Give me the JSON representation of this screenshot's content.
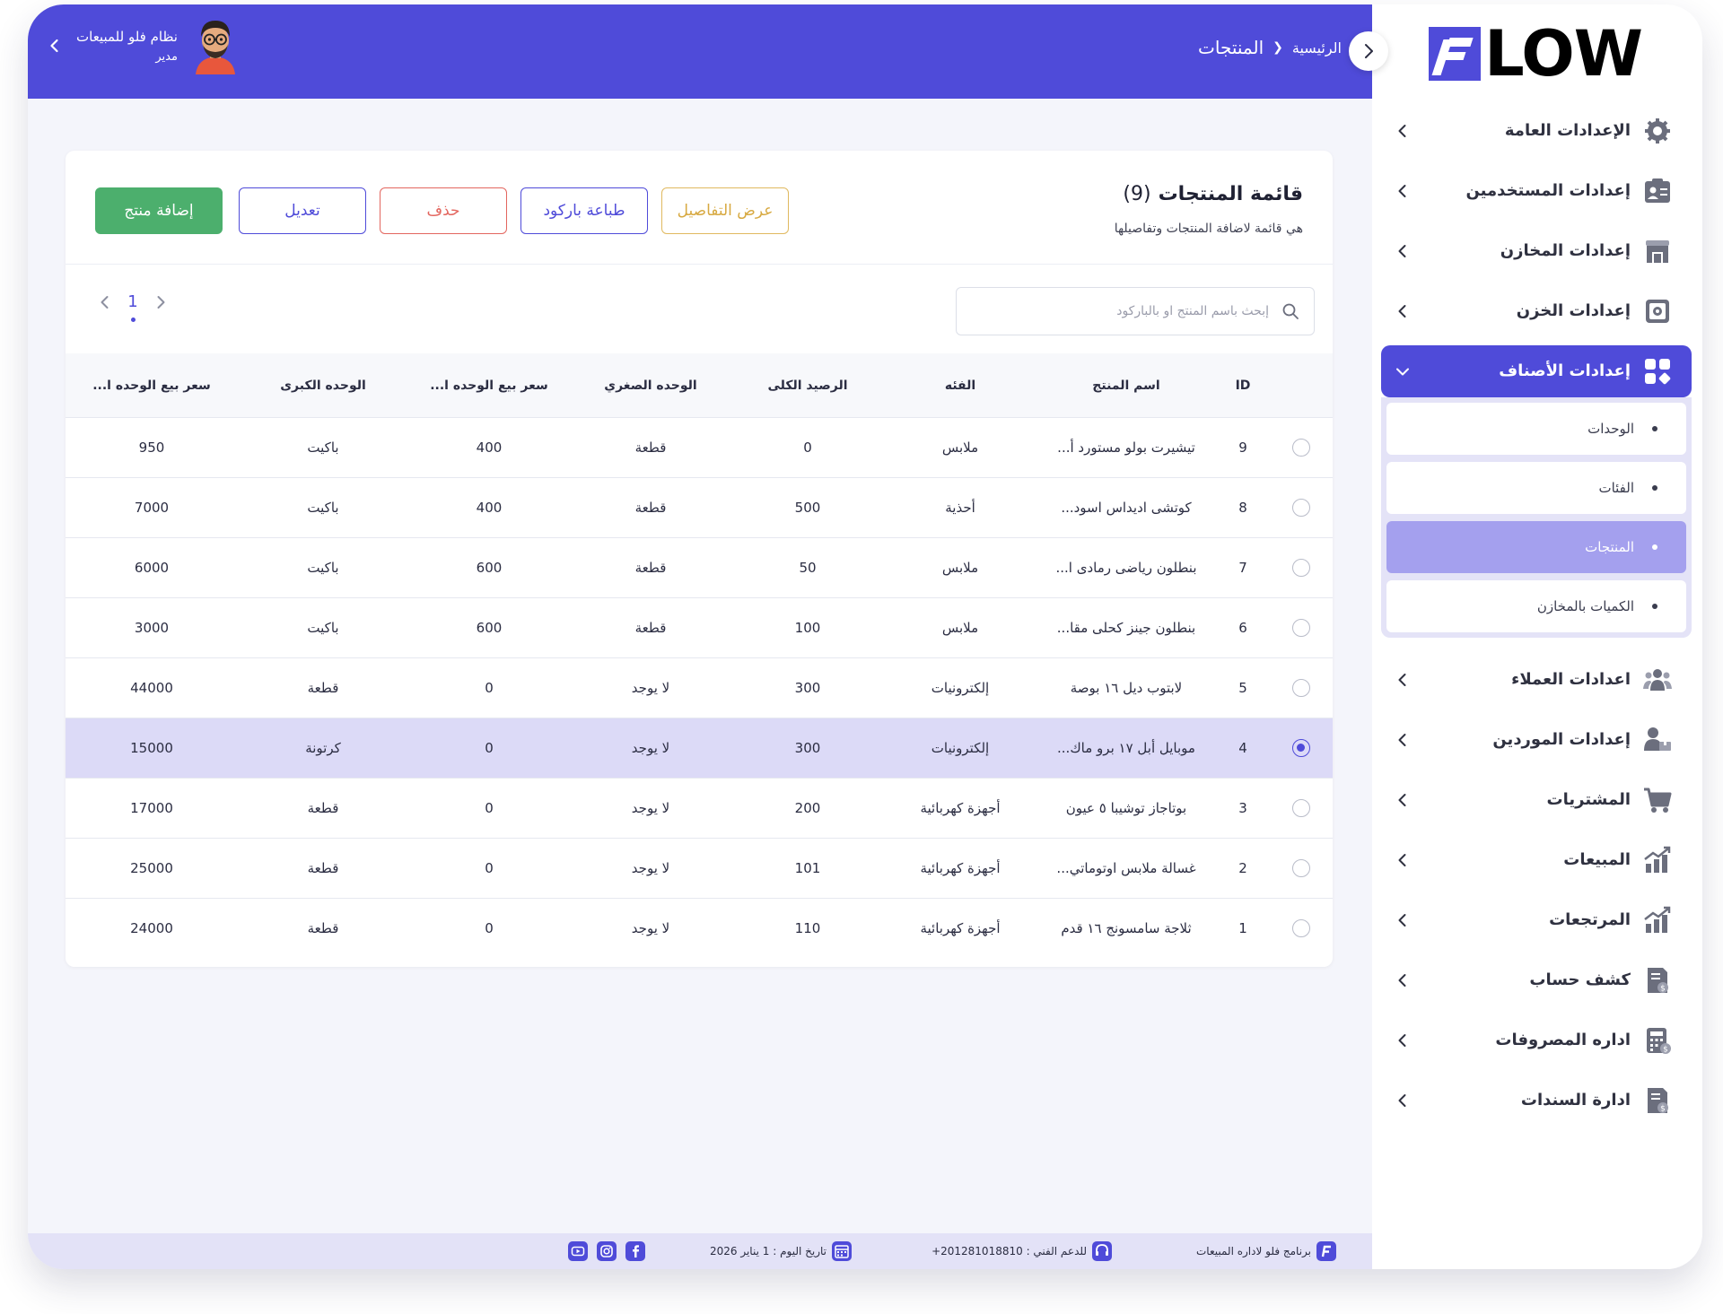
{
  "brand": {
    "logo_text": "LOW"
  },
  "header": {
    "breadcrumb_home": "الرئيسية",
    "breadcrumb_current": "المنتجات",
    "user_name": "نظام فلو للمبيعات",
    "user_role": "مدير"
  },
  "sidebar": {
    "items": [
      {
        "label": "الإعدادات العامة",
        "icon": "gear-icon"
      },
      {
        "label": "إعدادات المستخدمين",
        "icon": "users-card-icon"
      },
      {
        "label": "إعدادات المخازن",
        "icon": "store-icon"
      },
      {
        "label": "إعدادات الخزن",
        "icon": "safe-icon"
      },
      {
        "label": "إعدادات الأصناف",
        "icon": "grid-icon",
        "active": true
      },
      {
        "label": "اعدادات العملاء",
        "icon": "group-icon"
      },
      {
        "label": "إعدادات الموردين",
        "icon": "supplier-icon"
      },
      {
        "label": "المشتريات",
        "icon": "cart-icon"
      },
      {
        "label": "المبيعات",
        "icon": "chart-up-icon"
      },
      {
        "label": "المرتجعات",
        "icon": "chart-up-icon"
      },
      {
        "label": "كشف حساب",
        "icon": "statement-icon"
      },
      {
        "label": "اداره المصروفات",
        "icon": "calculator-icon"
      },
      {
        "label": "ادارة السندات",
        "icon": "receipt-icon"
      }
    ],
    "submenu": [
      {
        "label": "الوحدات"
      },
      {
        "label": "الفئات"
      },
      {
        "label": "المنتجات",
        "active": true
      },
      {
        "label": "الكميات بالمخازن"
      }
    ]
  },
  "card": {
    "title": "قائمة المنتجات",
    "count": "(9)",
    "subtitle": "هي قائمة لاضافة المنتجات وتفاصيلها",
    "buttons": {
      "details": "عرض التفاصيل",
      "barcode": "طباعة باركود",
      "delete": "حذف",
      "edit": "تعديل",
      "add": "إضافة منتج"
    },
    "search_placeholder": "إبحث باسم المنتج او بالباركود",
    "search_value": "",
    "page": "1"
  },
  "table": {
    "columns": [
      "ID",
      "اسم المنتج",
      "الفئه",
      "الرصيد الكلى",
      "الوحده الصغري",
      "سعر بيع الوحده ا...",
      "الوحده الكبرى",
      "سعر بيع الوحده ا..."
    ],
    "rows": [
      {
        "id": "9",
        "name": "تيشيرت بولو مستورد أ...",
        "category": "ملابس",
        "total": "0",
        "small_unit": "قطعة",
        "small_price": "400",
        "big_unit": "باكيت",
        "big_price": "950",
        "selected": false
      },
      {
        "id": "8",
        "name": "كوتشى اديداس اسود...",
        "category": "أحذية",
        "total": "500",
        "small_unit": "قطعة",
        "small_price": "400",
        "big_unit": "باكيت",
        "big_price": "7000",
        "selected": false
      },
      {
        "id": "7",
        "name": "بنطلون رياضى رمادى ا...",
        "category": "ملابس",
        "total": "50",
        "small_unit": "قطعة",
        "small_price": "600",
        "big_unit": "باكيت",
        "big_price": "6000",
        "selected": false
      },
      {
        "id": "6",
        "name": "بنطلون جينز كحلى مقا...",
        "category": "ملابس",
        "total": "100",
        "small_unit": "قطعة",
        "small_price": "600",
        "big_unit": "باكيت",
        "big_price": "3000",
        "selected": false
      },
      {
        "id": "5",
        "name": "لابتوب ديل ١٦ بوصة",
        "category": "إلكترونيات",
        "total": "300",
        "small_unit": "لا يوجد",
        "small_price": "0",
        "big_unit": "قطعة",
        "big_price": "44000",
        "selected": false
      },
      {
        "id": "4",
        "name": "موبايل أبل ١٧ برو ماك...",
        "category": "إلكترونيات",
        "total": "300",
        "small_unit": "لا يوجد",
        "small_price": "0",
        "big_unit": "كرتونة",
        "big_price": "15000",
        "selected": true
      },
      {
        "id": "3",
        "name": "بوتاجاز توشيبا ٥ عيون",
        "category": "أجهزة كهربائية",
        "total": "200",
        "small_unit": "لا يوجد",
        "small_price": "0",
        "big_unit": "قطعة",
        "big_price": "17000",
        "selected": false
      },
      {
        "id": "2",
        "name": "غسالة ملابس اوتوماتي...",
        "category": "أجهزة كهربائية",
        "total": "101",
        "small_unit": "لا يوجد",
        "small_price": "0",
        "big_unit": "قطعة",
        "big_price": "25000",
        "selected": false
      },
      {
        "id": "1",
        "name": "ثلاجة سامسونج ١٦ قدم",
        "category": "أجهزة كهربائية",
        "total": "110",
        "small_unit": "لا يوجد",
        "small_price": "0",
        "big_unit": "قطعة",
        "big_price": "24000",
        "selected": false
      }
    ]
  },
  "footer": {
    "program": "برنامج فلو لاداره المبيعات",
    "support": "للدعم الفني : 201281018810+",
    "date": "تاريخ اليوم : 1 يناير 2026",
    "social": [
      "facebook-icon",
      "instagram-icon",
      "youtube-icon"
    ]
  },
  "colors": {
    "primary": "#4f4bd9",
    "primary_light": "#a4a0ee",
    "success": "#4caf6d",
    "danger": "#e3665f",
    "warning": "#d7a941",
    "selected_row": "#dcdaf7"
  }
}
